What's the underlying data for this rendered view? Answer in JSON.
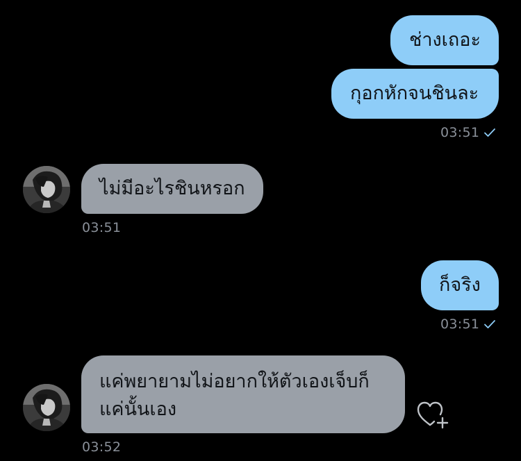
{
  "conversation": {
    "messages": [
      {
        "id": "m1",
        "direction": "outgoing",
        "text": "ช่างเถอะ"
      },
      {
        "id": "m2",
        "direction": "outgoing",
        "text": "กุอกหักจนชินละ",
        "time": "03:51",
        "status": "sent-check-icon"
      },
      {
        "id": "m3",
        "direction": "incoming",
        "text": "ไม่มีอะไรชินหรอก",
        "time": "03:51",
        "avatar": "profile-avatar"
      },
      {
        "id": "m4",
        "direction": "outgoing",
        "text": "ก็จริง",
        "time": "03:51",
        "status": "sent-check-icon"
      },
      {
        "id": "m5",
        "direction": "incoming",
        "lines": [
          "แค่พยายามไม่อยากให้ตัวเองเจ็บก็",
          "แค่นั้นเอง"
        ],
        "time": "03:52",
        "avatar": "profile-avatar",
        "action": "heart-plus-icon"
      }
    ]
  },
  "colors": {
    "background": "#000000",
    "outgoing_bubble": "#8ecdf8",
    "incoming_bubble": "#9aa0a8",
    "timestamp": "#8a9099",
    "check_mark": "#8ecdf8",
    "heart_icon": "#bfc3c8"
  }
}
